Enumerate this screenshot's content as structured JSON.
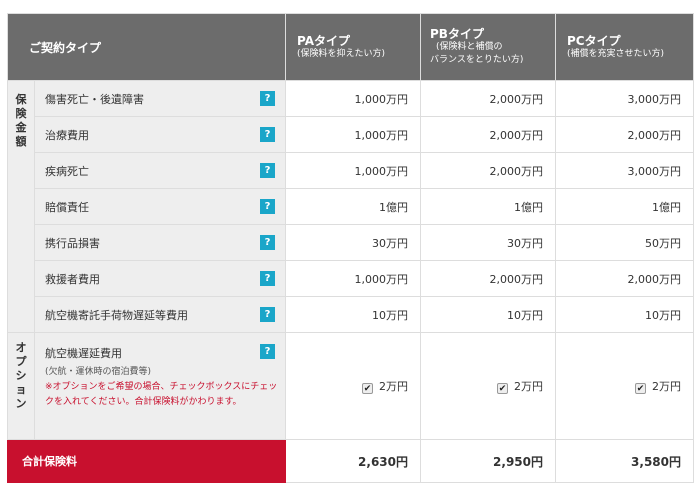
{
  "header": {
    "title": "ご契約タイプ",
    "plans": [
      {
        "name": "PAタイプ",
        "desc": "(保険料を抑えたい方)"
      },
      {
        "name": "PBタイプ",
        "desc": "(保険料と補償の",
        "desc2": "バランスをとりたい方)"
      },
      {
        "name": "PCタイプ",
        "desc": "(補償を充実させたい方)"
      }
    ]
  },
  "groups": {
    "coverage": [
      "保",
      "険",
      "金",
      "額"
    ],
    "option": [
      "オ",
      "プ",
      "シ",
      "ョ",
      "ン"
    ]
  },
  "help_icon": "?",
  "rows": [
    {
      "label": "傷害死亡・後遺障害",
      "values": [
        "1,000万円",
        "2,000万円",
        "3,000万円"
      ]
    },
    {
      "label": "治療費用",
      "values": [
        "1,000万円",
        "2,000万円",
        "2,000万円"
      ]
    },
    {
      "label": "疾病死亡",
      "values": [
        "1,000万円",
        "2,000万円",
        "3,000万円"
      ]
    },
    {
      "label": "賠償責任",
      "values": [
        "1億円",
        "1億円",
        "1億円"
      ]
    },
    {
      "label": "携行品損害",
      "values": [
        "30万円",
        "30万円",
        "50万円"
      ]
    },
    {
      "label": "救援者費用",
      "values": [
        "1,000万円",
        "2,000万円",
        "2,000万円"
      ]
    },
    {
      "label": "航空機寄託手荷物遅延等費用",
      "values": [
        "10万円",
        "10万円",
        "10万円"
      ]
    }
  ],
  "option": {
    "label": "航空機遅延費用",
    "sub": "(欠航・運休時の宿泊費等)",
    "note": "※オプションをご希望の場合、チェックボックスにチェックを入れてください。合計保険料がかわります。",
    "values": [
      "2万円",
      "2万円",
      "2万円"
    ],
    "check_mark": "✔"
  },
  "total": {
    "label": "合計保険料",
    "values": [
      "2,630円",
      "2,950円",
      "3,580円"
    ]
  }
}
